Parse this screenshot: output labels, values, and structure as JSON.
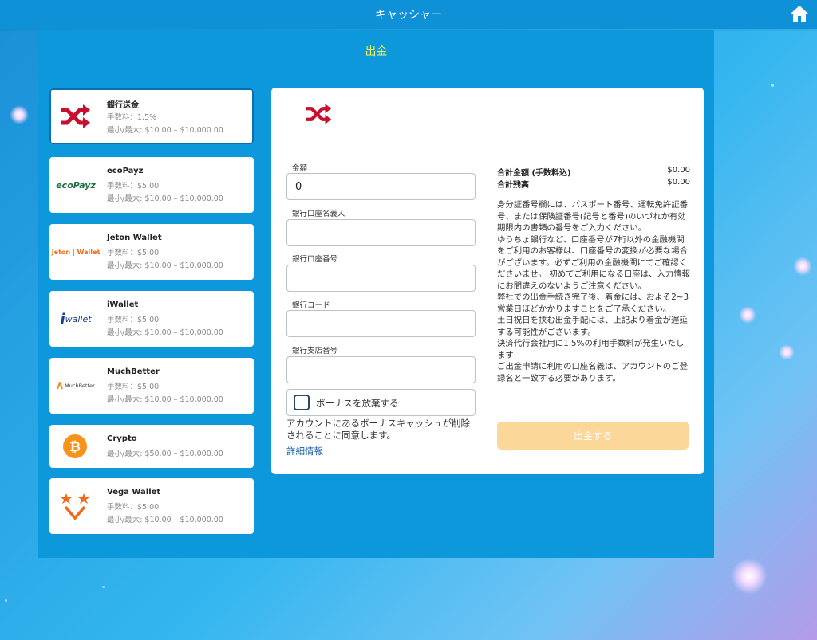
{
  "header": {
    "title": "キャッシャー",
    "home_icon": "home-icon"
  },
  "page": {
    "title": "出金"
  },
  "methods": [
    {
      "name": "銀行送金",
      "fee": "手数料：1.5%",
      "limits": "最小/最大: $10.00 – $10,000.00",
      "icon": "bank-transfer-icon",
      "selected": true
    },
    {
      "name": "ecoPayz",
      "fee": "手数料：$5.00",
      "limits": "最小/最大: $10.00 – $10,000.00",
      "icon": "ecopayz-logo",
      "logo_text": "ecoPayz"
    },
    {
      "name": "Jeton Wallet",
      "fee": "手数料：$5.00",
      "limits": "最小/最大: $10.00 – $10,000.00",
      "icon": "jeton-wallet-logo",
      "logo_text": "Jeton | Wallet"
    },
    {
      "name": "iWallet",
      "fee": "手数料：$5.00",
      "limits": "最小/最大: $10.00 – $10,000.00",
      "icon": "iwallet-logo",
      "logo_text": "wallet"
    },
    {
      "name": "MuchBetter",
      "fee": "手数料：$5.00",
      "limits": "最小/最大: $10.00 – $10,000.00",
      "icon": "muchbetter-logo",
      "logo_text": "MuchBetter"
    },
    {
      "name": "Crypto",
      "limits": "最小/最大: $50.00 – $10,000.00",
      "icon": "bitcoin-icon"
    },
    {
      "name": "Vega Wallet",
      "fee": "手数料：$5.00",
      "limits": "最小/最大: $10.00 – $10,000.00",
      "icon": "vega-wallet-logo"
    }
  ],
  "form": {
    "amount_label": "金額",
    "amount_value": "0",
    "account_holder_label": "銀行口座名義人",
    "account_holder_value": "",
    "account_number_label": "銀行口座番号",
    "account_number_value": "",
    "bank_code_label": "銀行コード",
    "bank_code_value": "",
    "branch_number_label": "銀行支店番号",
    "branch_number_value": "",
    "bonus_forfeit_label": "ボーナスを放棄する",
    "bonus_forfeit_checked": false,
    "consent_text": "アカウントにあるボーナスキャッシュが削除されることに同意します。",
    "details_link": "詳細情報"
  },
  "summary": {
    "total_amount_label": "合計金額 (手数料込)",
    "total_amount_value": "$0.00",
    "total_balance_label": "合計残高",
    "total_balance_value": "$0.00",
    "info_paragraphs": [
      "身分証番号欄には、パスポート番号、運転免許証番号、または保険証番号(記号と番号)のいづれか有効期限内の書類の番号をご入力ください。",
      "ゆうちょ銀行など、口座番号が7桁以外の金融機関をご利用のお客様は、口座番号の変換が必要な場合がございます。必ずご利用の金融機関にてご確認くださいませ。 初めてご利用になる口座は、入力情報にお間違えのないようご注意ください。",
      "弊社での出金手続き完了後、着金には、およそ2~3営業日ほどかかりますことをご了承ください。",
      "土日祝日を挟む出金手配には、上記より着金が遅延する可能性がございます。",
      "決済代行会社用に1.5%の利用手数料が発生いたします",
      "ご出金申請に利用の口座名義は、アカウントのご登録名と一致する必要があります。"
    ],
    "withdraw_button": "出金する"
  },
  "colors": {
    "topbar": "#0f91d8",
    "panel": "#0d98dc",
    "title_yellow": "#f6f05a",
    "button_disabled": "#fcd79a",
    "link": "#1b5fa8"
  }
}
